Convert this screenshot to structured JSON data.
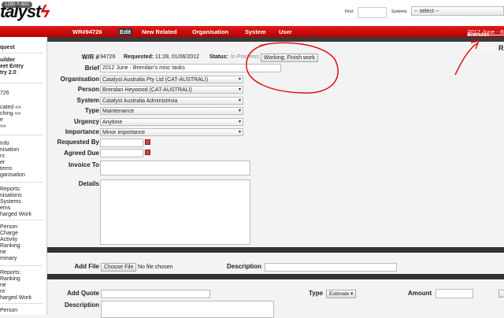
{
  "header": {
    "logo": "talyst",
    "resolution_badge": "1280 X 800",
    "find_label": "Find:",
    "systems_label": "Systems:",
    "systems_select": "-- select --"
  },
  "nav": {
    "wr": "WR#94726",
    "edit": "Edit",
    "new_related": "New Related",
    "organisation": "Organisation",
    "system": "System",
    "user": "User",
    "working_prefix": "Brendan Heywood is working on ",
    "working_link": "2012 June - B"
  },
  "sidebar": {
    "items": [
      "quest",
      "uilder",
      "eet Entry",
      "try 2.0",
      "726",
      "cated «»",
      "ching «»",
      "e",
      "«»",
      "Info",
      "nisation",
      "rs",
      "er",
      "tems",
      "ganisation",
      "Reports:",
      "nisations",
      "Systems",
      "ems",
      "harged Work",
      "Person",
      "Charge",
      "Activity",
      "Ranking",
      "rie",
      "mmary",
      "Reports:",
      "Ranking",
      "rie",
      "re",
      "harged Work",
      "Person"
    ]
  },
  "form": {
    "wr_label": "W/R #",
    "wr_value": "94726",
    "requested_label": "Requested:",
    "requested_value": "11:28, 01/06/2012",
    "status_label": "Status:",
    "status_value": "In Progress",
    "status_button": "Working: Finish work",
    "brief_label": "Brief",
    "brief_value": "2012 June - Brendan's misc tasks",
    "organisation_label": "Organisation",
    "organisation_value": "Catalyst Australia Pty Ltd (CAT-AUSTRALI)",
    "person_label": "Person",
    "person_value": "Brendan Heywood (CAT-AUSTRALI)",
    "system_label": "System",
    "system_value": "Catalyst Australia Administrivia",
    "type_label": "Type",
    "type_value": "Maintenance",
    "urgency_label": "Urgency",
    "urgency_value": "Anytime",
    "importance_label": "Importance",
    "importance_value": "Minor importance",
    "requested_by_label": "Requested By",
    "agreed_due_label": "Agreed Due",
    "invoice_to_label": "Invoice To",
    "details_label": "Details"
  },
  "file": {
    "add_file_label": "Add File",
    "choose_button": "Choose File",
    "no_file": "No file chosen",
    "description_label": "Description"
  },
  "quote": {
    "add_quote_label": "Add Quote",
    "type_label": "Type",
    "type_value": "Estimate",
    "amount_label": "Amount",
    "description_label": "Description"
  },
  "right_edge": "R"
}
